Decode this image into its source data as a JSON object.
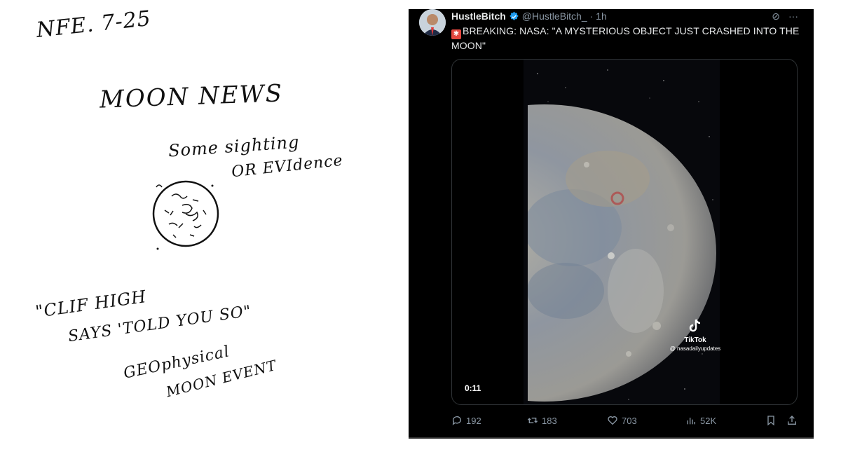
{
  "note": {
    "date": "NFE. 7-25",
    "title": "MOON NEWS",
    "line1": "Some sighting",
    "line2": "OR EVIdence",
    "quote1": "\"CLIF HIGH",
    "quote2": "SAYS 'TOLD YOU SO\"",
    "geo1": "GEOphysical",
    "geo2": "MOON EVENT"
  },
  "tweet": {
    "display_name": "HustleBitch",
    "handle": "@HustleBitch_",
    "time": "· 1h",
    "text": "BREAKING:  NASA: \"A MYSTERIOUS OBJECT JUST CRASHED INTO THE MOON\"",
    "video_time": "0:11",
    "watermark_brand": "TikTok",
    "watermark_user": "@ nasadailyupdates",
    "replies": "192",
    "retweets": "183",
    "likes": "703",
    "views": "52K",
    "more_label": "···",
    "grok_label": "⊘"
  },
  "colors": {
    "background": "#000000",
    "text": "#e7e9ea",
    "muted": "#8b98a5",
    "verified": "#1d9bf0"
  }
}
